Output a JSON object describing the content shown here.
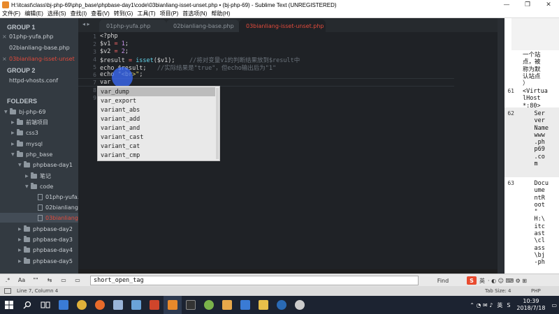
{
  "window": {
    "title": "H:\\itcast\\class\\bj-php-69\\php_base\\phpbase-day1\\code\\03bianliang-isset-unset.php • (bj-php-69) - Sublime Text (UNREGISTERED)",
    "controls": [
      "—",
      "❐",
      "✕"
    ]
  },
  "menu": [
    "文件(F)",
    "编辑(E)",
    "选择(S)",
    "查找(I)",
    "查看(V)",
    "转到(G)",
    "工具(T)",
    "项目(P)",
    "首选项(N)",
    "帮助(H)"
  ],
  "sidebar": {
    "group1": "GROUP 1",
    "group1_files": [
      {
        "name": "01php-yufa.php",
        "active": false
      },
      {
        "name": "02bianliang-base.php",
        "active": false
      },
      {
        "name": "03bianliang-isset-unset",
        "active": true
      }
    ],
    "group2": "GROUP 2",
    "group2_files": [
      {
        "name": "httpd-vhosts.conf",
        "active": false
      }
    ],
    "folders_label": "FOLDERS",
    "tree": [
      {
        "label": "bj-php-69",
        "type": "folder",
        "open": true
      },
      {
        "label": "前端项目",
        "type": "folder",
        "open": false
      },
      {
        "label": "css3",
        "type": "folder",
        "open": false
      },
      {
        "label": "mysql",
        "type": "folder",
        "open": false
      },
      {
        "label": "php_base",
        "type": "folder",
        "open": true
      },
      {
        "label": "phpbase-day1",
        "type": "folder",
        "open": true
      },
      {
        "label": "笔记",
        "type": "folder",
        "open": false
      },
      {
        "label": "code",
        "type": "folder",
        "open": true
      },
      {
        "label": "01php-yufa.p",
        "type": "file"
      },
      {
        "label": "02bianliang-t",
        "type": "file"
      },
      {
        "label": "03bianliang-i",
        "type": "file",
        "selected": true
      },
      {
        "label": "phpbase-day2",
        "type": "folder",
        "open": false
      },
      {
        "label": "phpbase-day3",
        "type": "folder",
        "open": false
      },
      {
        "label": "phpbase-day4",
        "type": "folder",
        "open": false
      },
      {
        "label": "phpbase-day5",
        "type": "folder",
        "open": false
      }
    ]
  },
  "tabs": [
    {
      "label": "01php-yufa.php",
      "active": false
    },
    {
      "label": "02bianliang-base.php",
      "active": false
    },
    {
      "label": "03bianliang-isset-unset.php",
      "active": true
    }
  ],
  "tab_arrows": "◂ ▸",
  "editor": {
    "line_numbers": [
      "1",
      "2",
      "3",
      "4",
      "5",
      "6",
      "7",
      "8",
      "9"
    ],
    "lines": {
      "l1": "<?php",
      "l2_var": "$v1",
      "l2_op": " = ",
      "l2_num": "1",
      "l2_end": ";",
      "l3_var": "$v2",
      "l3_op": " = ",
      "l3_num": "2",
      "l3_end": ";",
      "l4_var": "$result",
      "l4_op": " = ",
      "l4_fn": "isset",
      "l4_args": "($v1);",
      "l4_cmt": "    //将对变量v1的判断结果放到$result中",
      "l5_kw": "echo ",
      "l5_var": "$result",
      "l5_end": ";",
      "l5_cmt": "   //实际结果是\"true\"，但echo输出后为\"1\"",
      "l6_kw": "echo ",
      "l6_str": "\"<br>\"",
      "l6_end": ";",
      "l7": "var",
      "l8": "",
      "l9": ""
    }
  },
  "autocomplete": {
    "items": [
      "var_dump",
      "var_export",
      "variant_abs",
      "variant_add",
      "variant_and",
      "variant_cast",
      "variant_cat",
      "variant_cmp"
    ],
    "selected_index": 0
  },
  "right_pane": {
    "text_top": "一个站\n点，被\n称为默\n认站点\n）",
    "rows": [
      {
        "ln": "61",
        "text": "<Virtua\nlHost\n*:80>"
      },
      {
        "ln": "62",
        "text": "    Ser\n    ver\n    Name\n    www\n    .ph\n    p69\n    .co\n    m"
      },
      {
        "ln": "63",
        "text": "    Docu\n    ume\n    ntR\n    oot\n    \"\n    H:\\\n    itc\n    ast\n    \\cl\n    ass\n    \\bj\n    -ph"
      }
    ]
  },
  "findbar": {
    "options": [
      ".*",
      "Aa",
      "\"\"",
      "⇆",
      "▭",
      "▭"
    ],
    "query": "short_open_tag",
    "find_label": "Find",
    "ime": {
      "badge": "S",
      "lang": "英",
      "icons": "·  ◐  ☺  ⌨  ⚙  ⊞"
    }
  },
  "statusbar": {
    "position": "Line 7, Column 4",
    "tab_size": "Tab Size: 4",
    "syntax": "PHP"
  },
  "taskbar": {
    "apps": [
      {
        "name": "windows-start-icon",
        "color": "#ffffff"
      },
      {
        "name": "search-icon",
        "color": "#ffffff"
      },
      {
        "name": "task-view-icon",
        "color": "#ffffff"
      },
      {
        "name": "store-icon",
        "color": "#3a7bd5"
      },
      {
        "name": "chrome-icon",
        "color": "#e0b03a"
      },
      {
        "name": "firefox-icon",
        "color": "#e86a2a"
      },
      {
        "name": "notepad-icon",
        "color": "#9ab4d8"
      },
      {
        "name": "note-icon",
        "color": "#6aa3d8"
      },
      {
        "name": "powerpoint-icon",
        "color": "#d0452b"
      },
      {
        "name": "sublime-icon",
        "color": "#e8892b"
      },
      {
        "name": "terminal-icon",
        "color": "#333333"
      },
      {
        "name": "spider-icon",
        "color": "#7ab24a"
      },
      {
        "name": "image-icon",
        "color": "#e8a84a"
      },
      {
        "name": "pen-icon",
        "color": "#3a7bd5"
      },
      {
        "name": "folder-icon",
        "color": "#e8c04a"
      },
      {
        "name": "steam-icon",
        "color": "#2a6ab5"
      },
      {
        "name": "gear-icon",
        "color": "#cccccc"
      }
    ],
    "tray_lang": "英",
    "time": "10:39",
    "date": "2018/7/18"
  }
}
